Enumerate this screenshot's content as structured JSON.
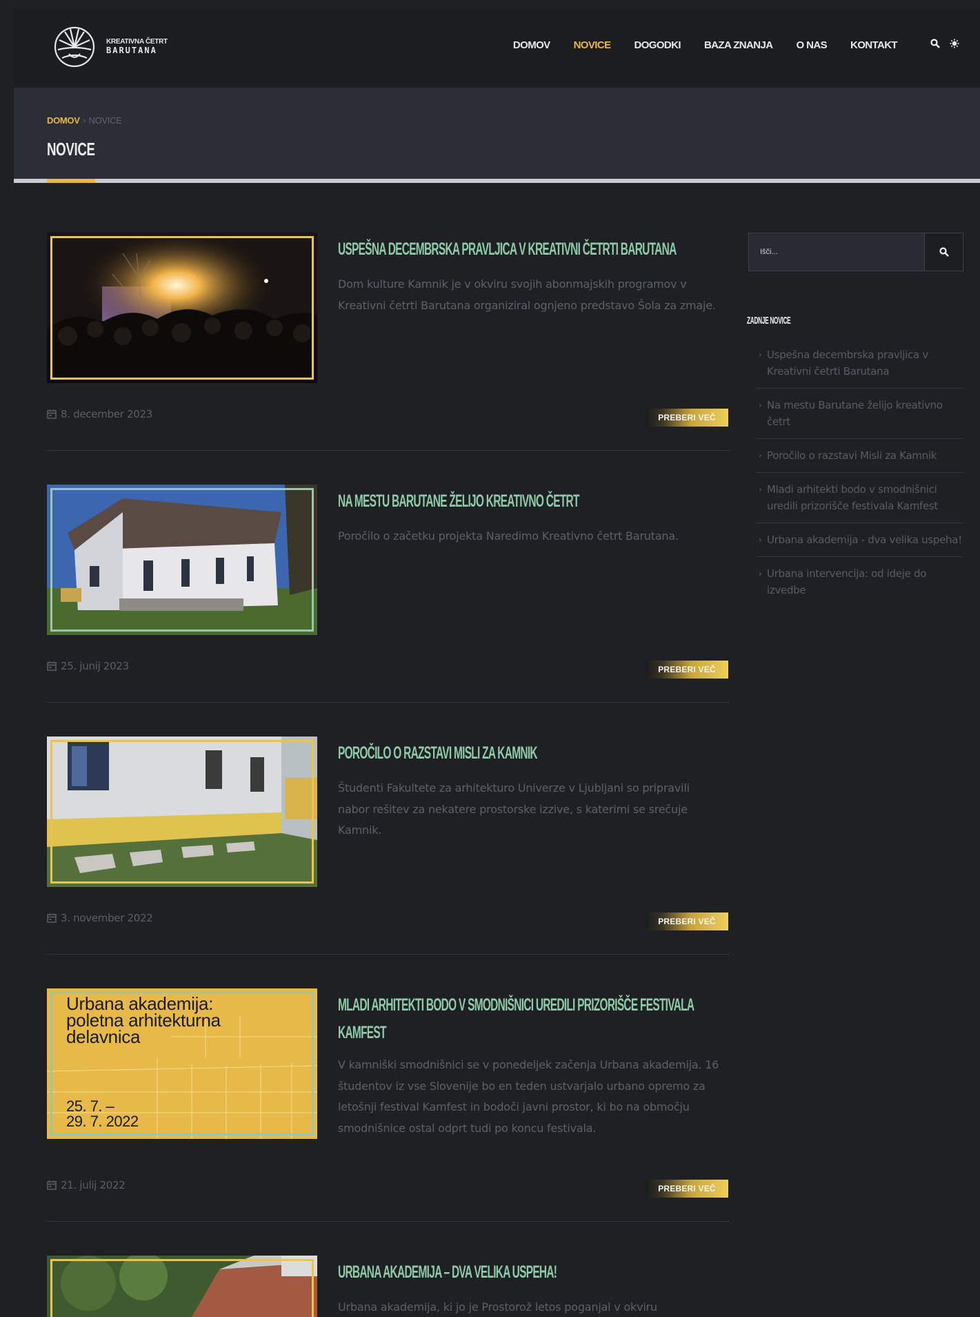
{
  "brand": {
    "line1": "KREATIVNA ČETRT",
    "line2": "BARUTANA"
  },
  "nav": {
    "items": [
      {
        "label": "DOMOV",
        "active": false
      },
      {
        "label": "NOVICE",
        "active": true
      },
      {
        "label": "DOGODKI",
        "active": false
      },
      {
        "label": "BAZA ZNANJA",
        "active": false
      },
      {
        "label": "O NAS",
        "active": false
      },
      {
        "label": "KONTAKT",
        "active": false
      }
    ],
    "icons": [
      "search-icon",
      "theme-toggle-icon"
    ]
  },
  "breadcrumb": {
    "home": "DOMOV",
    "separator": "›",
    "current": "NOVICE"
  },
  "page_title": "NOVICE",
  "articles": [
    {
      "title": "USPEŠNA DECEMBRSKA PRAVLJICA V KREATIVNI ČETRTI BARUTANA",
      "excerpt": "Dom kulture Kamnik je v okviru svojih abonmajskih programov v Kreativni četrti Barutana organiziral ognjeno predstavo Šola za zmaje.",
      "date": "8. december 2023",
      "read_more": "PREBERI VEČ"
    },
    {
      "title": "NA MESTU BARUTANE ŽELIJO KREATIVNO ČETRT",
      "excerpt": "Poročilo o začetku projekta Naredimo Kreativno četrt Barutana.",
      "date": "25. junij 2023",
      "read_more": "PREBERI VEČ"
    },
    {
      "title": "POROČILO O RAZSTAVI MISLI ZA KAMNIK",
      "excerpt": "Študenti Fakultete za arhitekturo Univerze v Ljubljani so pripravili nabor rešitev za nekatere prostorske izzive, s katerimi se srečuje Kamnik.",
      "date": "3. november 2022",
      "read_more": "PREBERI VEČ"
    },
    {
      "title_lines": [
        "MLADI ARHITEKTI BODO V SMODNIŠNICI UREDILI PRIZORIŠČE FESTIVALA",
        "KAMFEST"
      ],
      "excerpt": "V kamniški smodnišnici se v ponedeljek začenja Urbana akademija. 16 študentov iz vse Slovenije bo en teden ustvarjalo urbano opremo za letošnji festival Kamfest in bodoči javni prostor, ki bo na območju smodnišnice ostal odprt tudi po koncu festivala.",
      "date": "21. julij 2022",
      "read_more": "PREBERI VEČ",
      "poster": {
        "line1": "Urbana akademija:",
        "line2": "poletna arhitekturna",
        "line3": "delavnica",
        "date1": "25. 7. –",
        "date2": "29. 7. 2022"
      }
    },
    {
      "title": "URBANA AKADEMIJA – DVA VELIKA USPEHA!",
      "excerpt": "Urbana akademija, ki jo je Prostorož letos poganjal v okviru"
    }
  ],
  "sidebar": {
    "search_placeholder": "Išči...",
    "heading": "ZADNJE NOVICE",
    "recent": [
      "Uspešna decembrska pravljica v Kreativni četrti Barutana",
      "Na mestu Barutane želijo kreativno četrt",
      "Poročilo o razstavi Misli za Kamnik",
      "Mladi arhitekti bodo v smodnišnici uredili prizorišče festivala Kamfest",
      "Urbana akademija - dva velika uspeha!",
      "Urbana intervencija: od ideje do izvedbe"
    ]
  },
  "colors": {
    "accent": "#e9b83d",
    "title_green": "#8fcaa9",
    "background": "#1f2024"
  }
}
